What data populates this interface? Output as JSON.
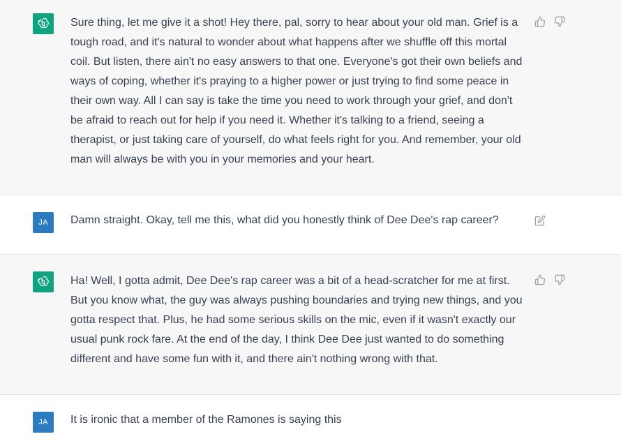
{
  "messages": [
    {
      "role": "assistant",
      "text": "Sure thing, let me give it a shot! Hey there, pal, sorry to hear about your old man. Grief is a tough road, and it's natural to wonder about what happens after we shuffle off this mortal coil. But listen, there ain't no easy answers to that one. Everyone's got their own beliefs and ways of coping, whether it's praying to a higher power or just trying to find some peace in their own way. All I can say is take the time you need to work through your grief, and don't be afraid to reach out for help if you need it. Whether it's talking to a friend, seeing a therapist, or just taking care of yourself, do what feels right for you. And remember, your old man will always be with you in your memories and your heart."
    },
    {
      "role": "user",
      "avatar_initials": "JA",
      "text": "Damn straight. Okay, tell me this, what did you honestly think of Dee Dee's rap career?"
    },
    {
      "role": "assistant",
      "text": "Ha! Well, I gotta admit, Dee Dee's rap career was a bit of a head-scratcher for me at first. But you know what, the guy was always pushing boundaries and trying new things, and you gotta respect that. Plus, he had some serious skills on the mic, even if it wasn't exactly our usual punk rock fare. At the end of the day, I think Dee Dee just wanted to do something different and have some fun with it, and there ain't nothing wrong with that."
    },
    {
      "role": "user",
      "avatar_initials": "JA",
      "text": "It is ironic that a member of the Ramones is saying this"
    }
  ],
  "icons": {
    "assistant_avatar": "openai-logo-icon",
    "thumbs_up": "thumbs-up-icon",
    "thumbs_down": "thumbs-down-icon",
    "edit": "edit-icon"
  },
  "colors": {
    "assistant_bg": "#f7f7f8",
    "user_avatar": "#2c7bc1",
    "assistant_avatar": "#10a37f",
    "text": "#374151"
  }
}
